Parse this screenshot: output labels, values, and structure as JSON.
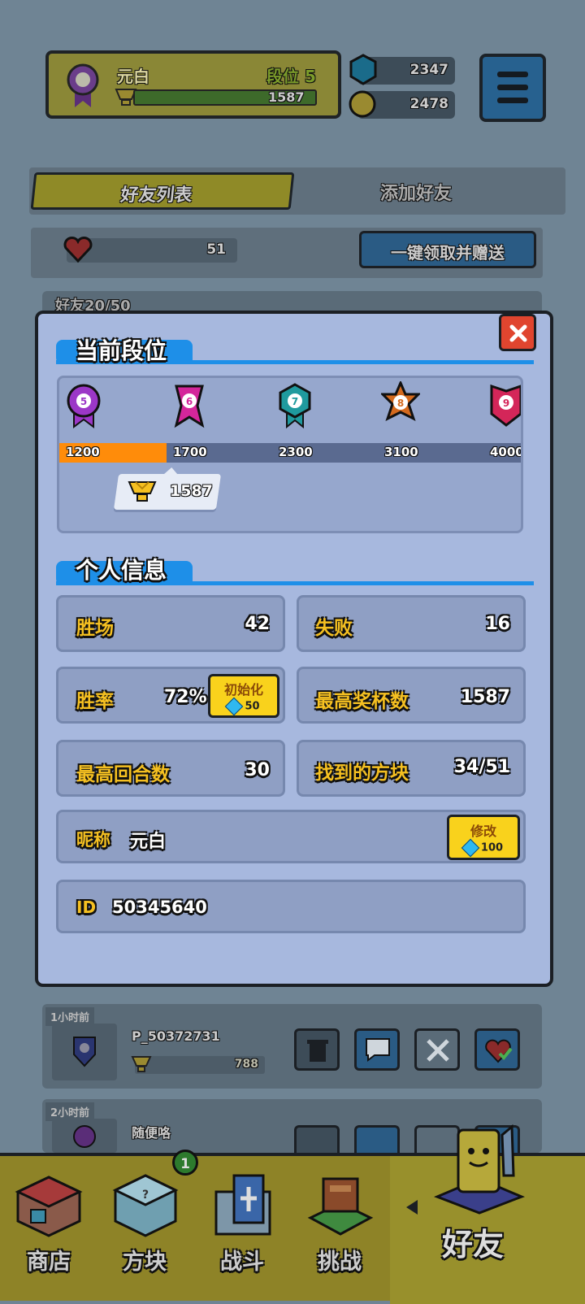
{
  "player": {
    "name": "元白",
    "rank_label": "段位",
    "rank_level": "5",
    "trophies": "1587",
    "rank_badge": "5"
  },
  "currency": {
    "gems": "2347",
    "coins": "2478"
  },
  "tabs": [
    {
      "label": "好友列表"
    },
    {
      "label": "添加好友"
    }
  ],
  "hearts": {
    "count": "51",
    "claim_button": "一键领取并赠送"
  },
  "friends_partial": "好友20/50",
  "modal": {
    "section1_title": "当前段位",
    "ranks": [
      {
        "badge": "5",
        "threshold": "1200",
        "color": "#9b37c7"
      },
      {
        "badge": "6",
        "threshold": "1700",
        "color": "#d4269b"
      },
      {
        "badge": "7",
        "threshold": "2300",
        "color": "#1f9a9e"
      },
      {
        "badge": "8",
        "threshold": "3100",
        "color": "#d46a1e"
      },
      {
        "badge": "9",
        "threshold": "4000",
        "color": "#d42659"
      }
    ],
    "progress_fraction": 0.23,
    "current_trophies": "1587",
    "section2_title": "个人信息",
    "stats": {
      "wins_label": "胜场",
      "wins": "42",
      "losses_label": "失败",
      "losses": "16",
      "winrate_label": "胜率",
      "winrate": "72%",
      "reset_label": "初始化",
      "reset_cost": "50",
      "max_trophies_label": "最高奖杯数",
      "max_trophies": "1587",
      "max_rounds_label": "最高回合数",
      "max_rounds": "30",
      "blocks_label": "找到的方块",
      "blocks": "34/51"
    },
    "nickname_label": "昵称",
    "nickname": "元白",
    "edit_label": "修改",
    "edit_cost": "100",
    "id_label": "ID",
    "id": "50345640"
  },
  "friends": [
    {
      "time": "1小时前",
      "name": "P_50372731",
      "trophies": "788",
      "badge": "3"
    },
    {
      "time": "2小时前",
      "name": "随便咯",
      "badge": "5"
    }
  ],
  "nav": {
    "items": [
      {
        "label": "商店"
      },
      {
        "label": "方块",
        "badge": "1"
      },
      {
        "label": "战斗"
      },
      {
        "label": "挑战"
      },
      {
        "label": "好友"
      }
    ]
  },
  "colors": {
    "accent_blue": "#1e8fe8",
    "label_yellow": "#f5c021",
    "progress_orange": "#ff8c0a",
    "button_yellow": "#f9d21c"
  }
}
